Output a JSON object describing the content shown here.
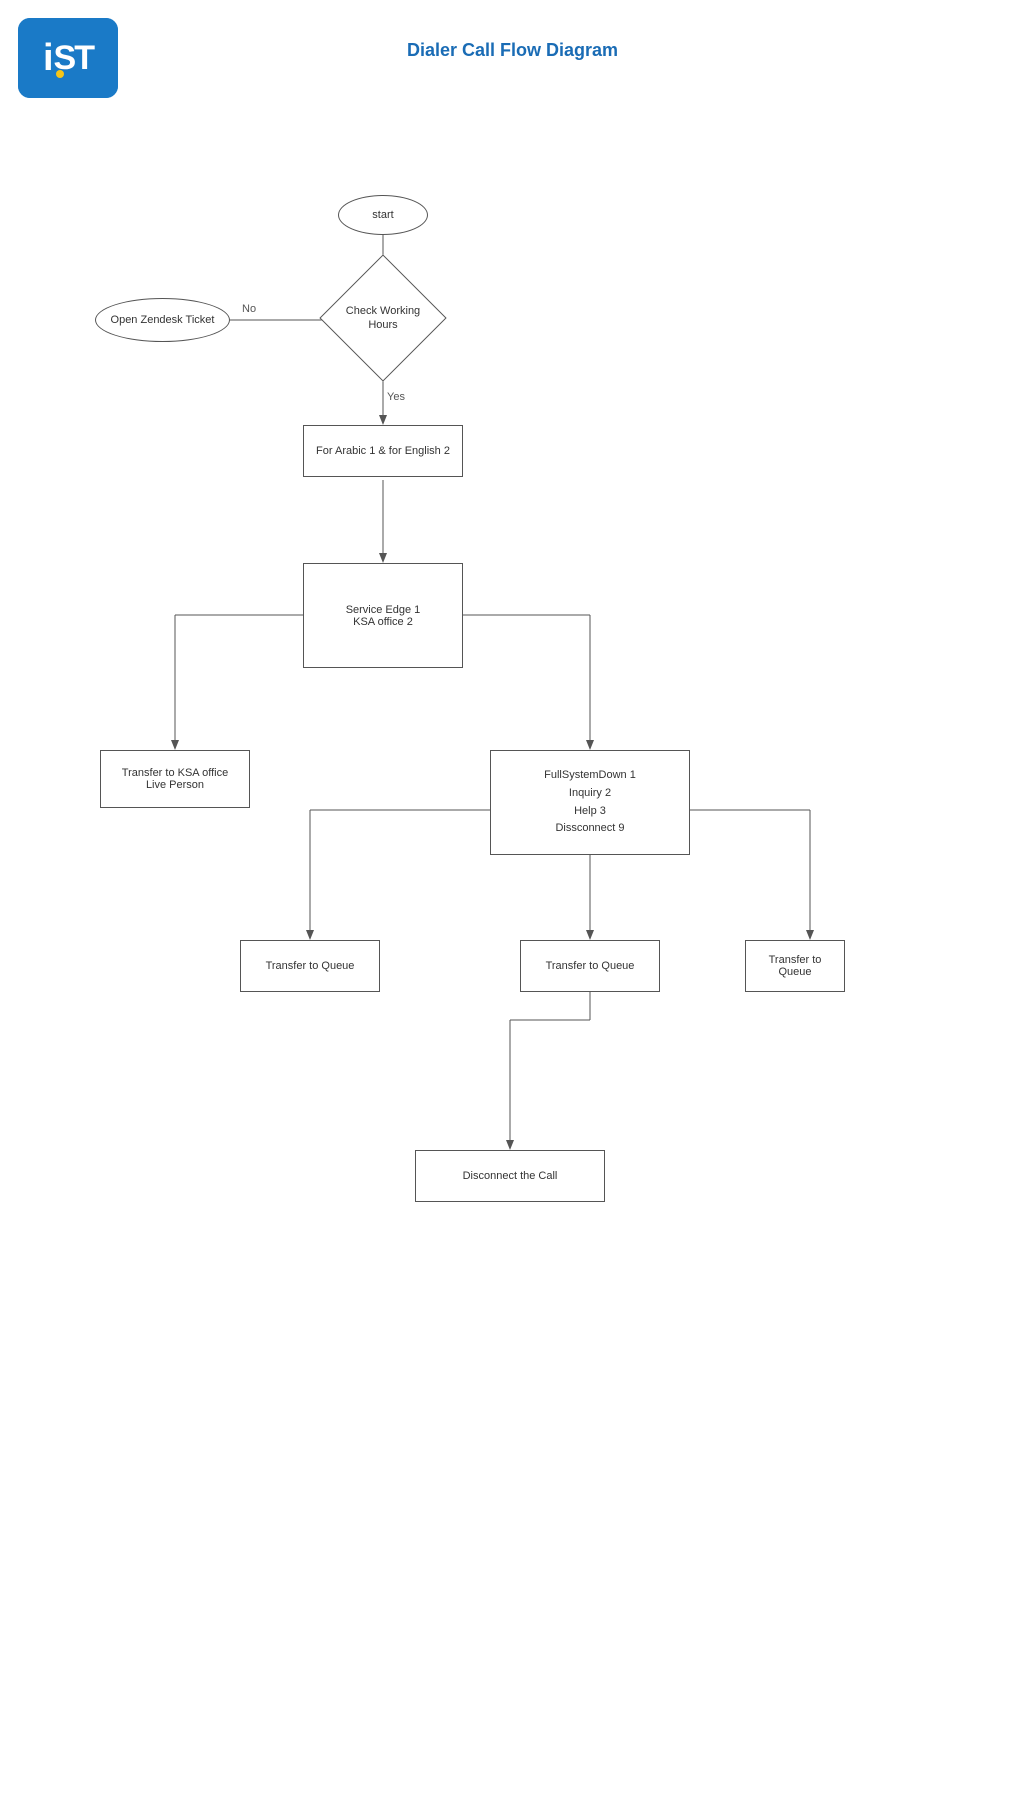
{
  "logo": {
    "text": "iST",
    "dot_color": "#f5c518",
    "bg_color": "#1a7ac7"
  },
  "title": "Dialer Call Flow Diagram",
  "nodes": {
    "start": {
      "label": "start"
    },
    "check_working_hours": {
      "label": "Check Working\nHours"
    },
    "open_zendesk": {
      "label": "Open Zendesk Ticket"
    },
    "arabic_english": {
      "label": "For Arabic 1 & for English 2"
    },
    "service_edge": {
      "label": "Service Edge 1\nKSA office 2"
    },
    "transfer_ksa": {
      "label": "Transfer to KSA office\nLive Person"
    },
    "full_system_down": {
      "label": "FullSystemDown 1\nInquiry 2\nHelp 3\nDissconnect 9"
    },
    "transfer_queue_1": {
      "label": "Transfer to Queue"
    },
    "transfer_queue_2": {
      "label": "Transfer to Queue"
    },
    "transfer_queue_3": {
      "label": "Transfer to\nQueue"
    },
    "disconnect": {
      "label": "Disconnect the Call"
    }
  },
  "labels": {
    "no": "No",
    "yes": "Yes"
  }
}
